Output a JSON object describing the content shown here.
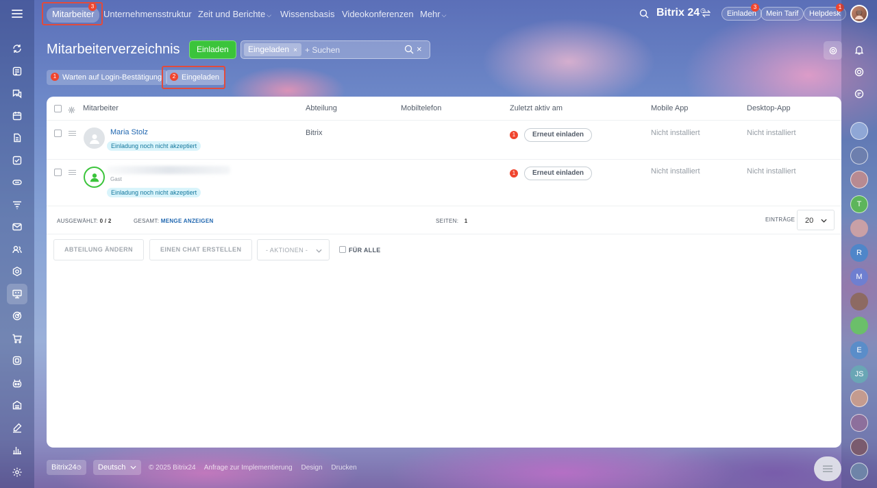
{
  "colors": {
    "accent_green": "#3bc43b",
    "badge_red": "#f0452e",
    "link_blue": "#2067b0",
    "highlight_red": "#e24b3b",
    "status_badge_bg": "#d9f4fb"
  },
  "top_nav": {
    "items": [
      {
        "label": "Mitarbeiter",
        "badge": "3"
      },
      {
        "label": "Unternehmensstruktur"
      },
      {
        "label": "Zeit und Berichte"
      },
      {
        "label": "Wissensbasis"
      },
      {
        "label": "Videokonferenzen"
      },
      {
        "label": "Mehr"
      }
    ],
    "caret": "⌵",
    "logo": "Bitrix 24",
    "logo_mark": "◷",
    "invite_label": "Einladen",
    "invite_badge": "3",
    "tariff_label": "Mein Tarif",
    "helpdesk_label": "Helpdesk",
    "helpdesk_badge": "1"
  },
  "page": {
    "title": "Mitarbeiterverzeichnis",
    "invite_button": "Einladen"
  },
  "search": {
    "chip_label": "Eingeladen",
    "chip_close": "×",
    "placeholder": "+ Suchen",
    "clear": "×"
  },
  "presets": [
    {
      "count": "1",
      "label": "Warten auf Login-Bestätigung"
    },
    {
      "count": "2",
      "label": "Eingeladen"
    }
  ],
  "table": {
    "columns": [
      "Mitarbeiter",
      "Abteilung",
      "Mobiltelefon",
      "Zuletzt aktiv am",
      "Mobile App",
      "Desktop-App"
    ],
    "rows": [
      {
        "name": "Maria Stolz",
        "status": "Einladung noch nicht akzeptiert",
        "department": "Bitrix",
        "counter": "1",
        "action": "Erneut einladen",
        "mobile_app": "Nicht installiert",
        "desktop_app": "Nicht installiert"
      },
      {
        "name": "",
        "role": "Gast",
        "status": "Einladung noch nicht akzeptiert",
        "department": "",
        "counter": "1",
        "action": "Erneut einladen",
        "mobile_app": "Nicht installiert",
        "desktop_app": "Nicht installiert"
      }
    ]
  },
  "table_footer": {
    "selected_label": "AUSGEWÄHLT:",
    "selected_value": "0 / 2",
    "total_label": "GESAMT:",
    "total_link": "MENGE ANZEIGEN",
    "pages_label": "SEITEN:",
    "pages_value": "1",
    "entries_label": "EINTRÄGE",
    "entries_value": "20"
  },
  "actions": {
    "change_department": "ABTEILUNG ÄNDERN",
    "create_chat": "EINEN CHAT ERSTELLEN",
    "actions_select": "- AKTIONEN -",
    "for_all": "FÜR ALLE"
  },
  "footer": {
    "brand": "Bitrix24",
    "brand_mark": "◷",
    "language": "Deutsch",
    "copyright": "© 2025 Bitrix24",
    "links": [
      "Anfrage zur Implementierung",
      "Design",
      "Drucken"
    ]
  },
  "right_bar": {
    "avatars": [
      "R",
      "M",
      "T",
      "E",
      "JS"
    ]
  },
  "icons": {
    "left": [
      "sync-icon",
      "news-feed-icon",
      "chat-icon",
      "calendar-icon",
      "documents-icon",
      "tasks-icon",
      "crm-icon",
      "filter-icon",
      "mail-icon",
      "employees-icon",
      "automation-icon",
      "presentation-icon",
      "goals-icon",
      "shop-icon",
      "sites-icon",
      "robot-icon",
      "inventory-icon",
      "sign-icon",
      "analytics-icon",
      "settings-icon"
    ]
  }
}
